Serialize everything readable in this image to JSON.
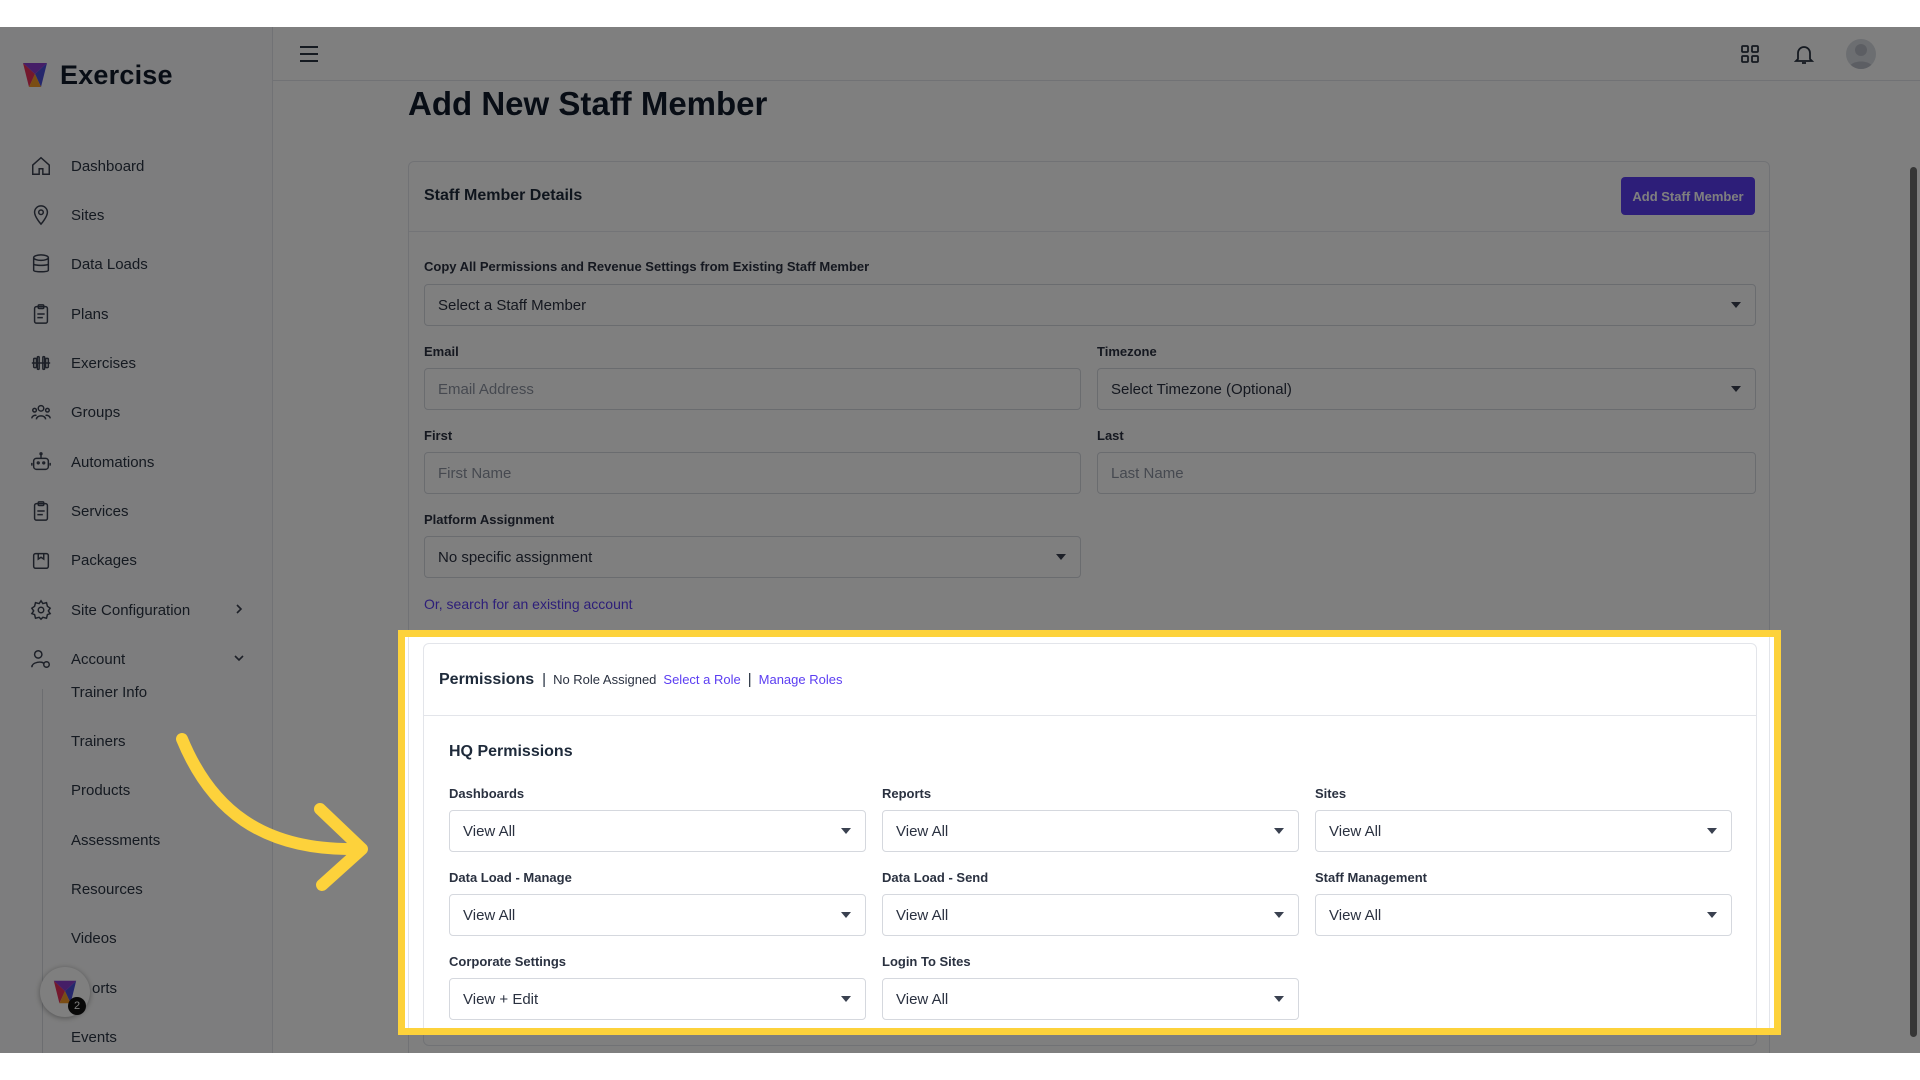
{
  "app": {
    "name": "Exercise"
  },
  "sidebar": {
    "items": [
      {
        "label": "Dashboard",
        "icon": "home-icon"
      },
      {
        "label": "Sites",
        "icon": "map-pin-icon"
      },
      {
        "label": "Data Loads",
        "icon": "database-icon"
      },
      {
        "label": "Plans",
        "icon": "clipboard-icon"
      },
      {
        "label": "Exercises",
        "icon": "dumbbell-icon"
      },
      {
        "label": "Groups",
        "icon": "users-icon"
      },
      {
        "label": "Automations",
        "icon": "robot-icon"
      },
      {
        "label": "Services",
        "icon": "clipboard-icon"
      },
      {
        "label": "Packages",
        "icon": "package-icon"
      },
      {
        "label": "Site Configuration",
        "icon": "gear-icon"
      },
      {
        "label": "Account",
        "icon": "user-gear-icon"
      }
    ],
    "sub_items": [
      "Trainer Info",
      "Trainers",
      "Products",
      "Assessments",
      "Resources",
      "Videos",
      "orts",
      "Events"
    ],
    "badge_count": "2"
  },
  "page": {
    "title": "Add New Staff Member"
  },
  "form": {
    "section_title": "Staff Member Details",
    "submit_label": "Add Staff Member",
    "copy_label": "Copy All Permissions and Revenue Settings from Existing Staff Member",
    "copy_value": "Select a Staff Member",
    "email_label": "Email",
    "email_placeholder": "Email Address",
    "timezone_label": "Timezone",
    "timezone_value": "Select Timezone (Optional)",
    "first_label": "First",
    "first_placeholder": "First Name",
    "last_label": "Last",
    "last_placeholder": "Last Name",
    "platform_label": "Platform Assignment",
    "platform_value": "No specific assignment",
    "search_link": "Or, search for an existing account"
  },
  "permissions": {
    "title": "Permissions",
    "separator": "|",
    "role_status": "No Role Assigned",
    "select_role": "Select a Role",
    "manage_roles": "Manage Roles",
    "hq_title": "HQ Permissions",
    "fields": [
      {
        "label": "Dashboards",
        "value": "View All"
      },
      {
        "label": "Reports",
        "value": "View All"
      },
      {
        "label": "Sites",
        "value": "View All"
      },
      {
        "label": "Data Load - Manage",
        "value": "View All"
      },
      {
        "label": "Data Load - Send",
        "value": "View All"
      },
      {
        "label": "Staff Management",
        "value": "View All"
      },
      {
        "label": "Corporate Settings",
        "value": "View + Edit"
      },
      {
        "label": "Login To Sites",
        "value": "View All"
      }
    ]
  },
  "colors": {
    "accent": "#5b3df2",
    "highlight": "#fdd23b"
  }
}
